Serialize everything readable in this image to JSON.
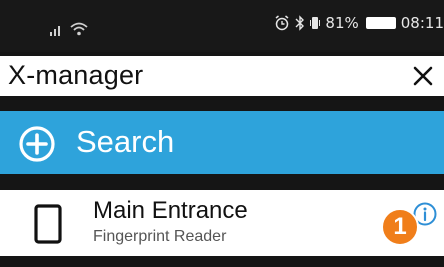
{
  "status_bar": {
    "icons": [
      "signal-icon",
      "wifi-icon",
      "alarm-icon",
      "bluetooth-icon",
      "vibrate-icon",
      "battery-icon"
    ],
    "battery": "81%",
    "time": "08:11"
  },
  "header": {
    "title": "X-manager",
    "close_icon": "close-icon"
  },
  "search_button": {
    "label": "Search",
    "icon": "plus-circle-icon"
  },
  "devices": [
    {
      "name": "Main Entrance",
      "type": "Fingerprint Reader",
      "icon": "phone-icon",
      "badge": "1",
      "action_icon": "info-icon"
    }
  ],
  "colors": {
    "background": "#151515",
    "accent": "#2ea3db",
    "badge": "#f07e1a",
    "info": "#2e8fd6"
  }
}
